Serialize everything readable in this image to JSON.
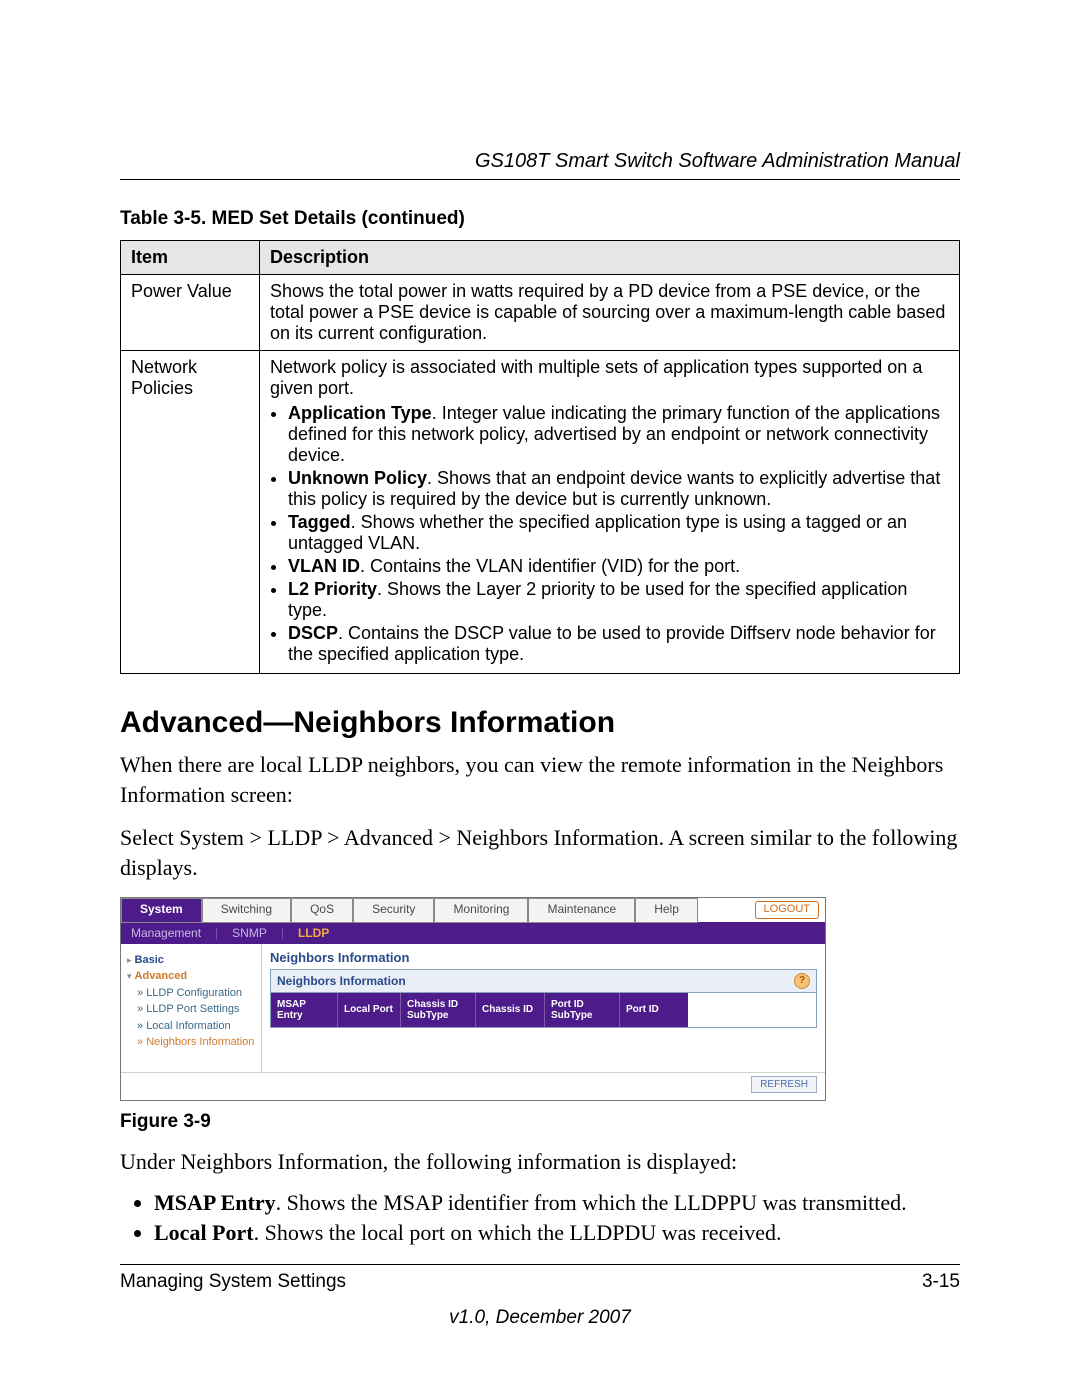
{
  "header": {
    "title": "GS108T Smart Switch Software Administration Manual"
  },
  "table": {
    "caption": "Table 3-5.  MED Set Details  (continued)",
    "headers": {
      "item": "Item",
      "desc": "Description"
    },
    "rows": [
      {
        "item": "Power Value",
        "desc": "Shows the total power in watts required by a PD device from a PSE device, or the total power a PSE device is capable of sourcing over a maximum-length cable based on its current configuration."
      },
      {
        "item": "Network Policies",
        "desc_intro": "Network policy is associated with multiple sets of application types supported on a given port.",
        "bullets": [
          {
            "b": "Application Type",
            "t": ". Integer value indicating the primary function of the applications defined for this network policy, advertised by an endpoint or network connectivity device."
          },
          {
            "b": "Unknown Policy",
            "t": ". Shows that an endpoint device wants to explicitly advertise that this policy is required by the device but is currently unknown."
          },
          {
            "b": "Tagged",
            "t": ". Shows whether the specified application type is using a tagged or an untagged VLAN."
          },
          {
            "b": "VLAN ID",
            "t": ". Contains the VLAN identifier (VID) for the port."
          },
          {
            "b": "L2 Priority",
            "t": ". Shows the Layer 2 priority to be used for the specified application type."
          },
          {
            "b": "DSCP",
            "t": ". Contains the DSCP value to be used to provide Diffserv node behavior for the specified application type."
          }
        ]
      }
    ]
  },
  "section": {
    "heading": "Advanced—Neighbors Information",
    "p1": "When there are local LLDP neighbors, you can view the remote information in the Neighbors Information screen:",
    "p2": "Select System > LLDP > Advanced > Neighbors Information. A screen similar to the following displays."
  },
  "screenshot": {
    "tabs": [
      "System",
      "Switching",
      "QoS",
      "Security",
      "Monitoring",
      "Maintenance",
      "Help"
    ],
    "logout": "LOGOUT",
    "subtabs": [
      "Management",
      "SNMP",
      "LLDP"
    ],
    "subtabs_sel_index": 2,
    "side": {
      "basic": "Basic",
      "advanced": "Advanced",
      "items": [
        "LLDP Configuration",
        "LLDP Port Settings",
        "Local Information",
        "Neighbors Information"
      ],
      "current_index": 3
    },
    "main_title": "Neighbors Information",
    "box_title": "Neighbors Information",
    "columns": [
      "MSAP Entry",
      "Local Port",
      "Chassis ID SubType",
      "Chassis ID",
      "Port ID SubType",
      "Port ID"
    ],
    "refresh": "REFRESH"
  },
  "figure_caption": "Figure 3-9",
  "after_fig": {
    "intro": "Under Neighbors Information, the following information is displayed:",
    "bullets": [
      {
        "b": "MSAP Entry",
        "t": ". Shows the MSAP identifier from which the LLDPPU was transmitted."
      },
      {
        "b": "Local Port",
        "t": ". Shows the local port on which the LLDPDU was received."
      }
    ]
  },
  "footer": {
    "left": "Managing System Settings",
    "right": "3-15",
    "version": "v1.0, December 2007"
  }
}
